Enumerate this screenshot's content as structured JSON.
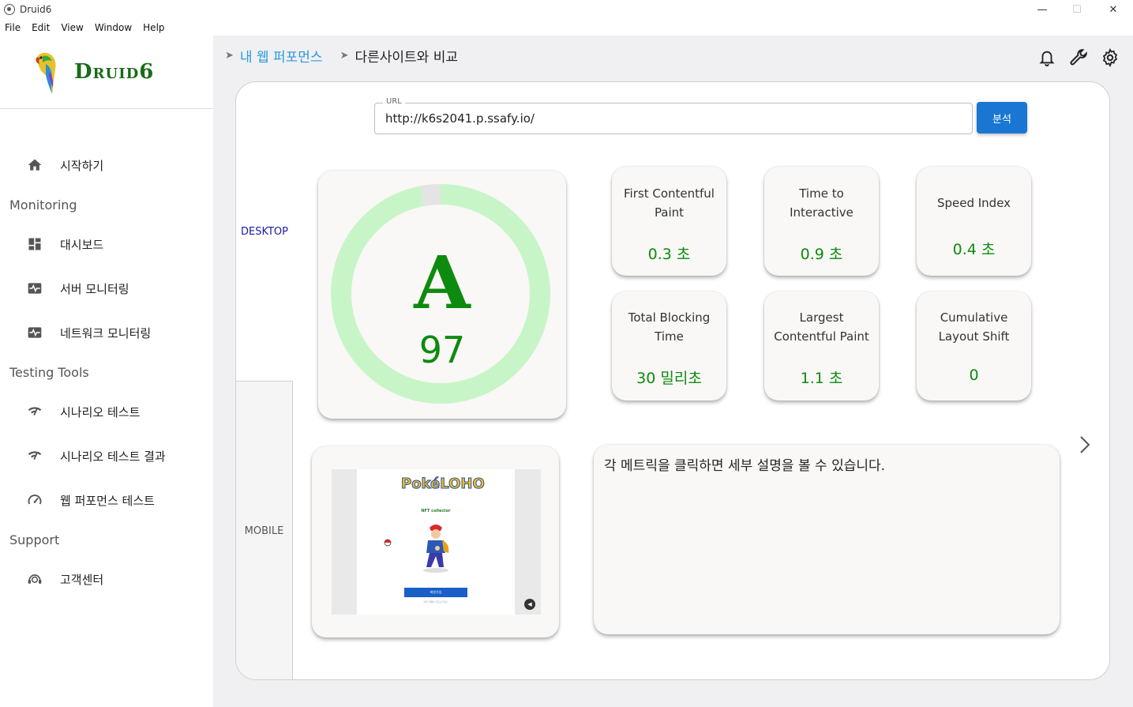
{
  "window": {
    "title": "Druid6",
    "minimize": "—",
    "maximize": "☐",
    "close": "✕"
  },
  "menu": [
    "File",
    "Edit",
    "View",
    "Window",
    "Help"
  ],
  "brand": {
    "name": "Druid6"
  },
  "sidebar": {
    "start": {
      "label": "시작하기",
      "icon": "home-icon"
    },
    "sections": [
      {
        "title": "Monitoring",
        "items": [
          {
            "label": "대시보드",
            "icon": "dashboard-icon"
          },
          {
            "label": "서버 모니터링",
            "icon": "monitor-heart-icon"
          },
          {
            "label": "네트워크 모니터링",
            "icon": "monitor-heart-icon"
          }
        ]
      },
      {
        "title": "Testing Tools",
        "items": [
          {
            "label": "시나리오 테스트",
            "icon": "network-check-icon"
          },
          {
            "label": "시나리오 테스트 결과",
            "icon": "network-check-icon"
          },
          {
            "label": "웹 퍼포먼스 테스트",
            "icon": "speed-icon"
          }
        ]
      },
      {
        "title": "Support",
        "items": [
          {
            "label": "고객센터",
            "icon": "support-agent-icon"
          }
        ]
      }
    ]
  },
  "breadcrumb": {
    "parent": "내 웹 퍼포먼스",
    "current": "다른사이트와 비교"
  },
  "header_icons": [
    "bell-icon",
    "wrench-icon",
    "gear-icon"
  ],
  "url_field": {
    "label": "URL",
    "value": "http://k6s2041.p.ssafy.io/"
  },
  "analyze_button": "분석",
  "tabs": {
    "desktop": "DESKTOP",
    "mobile": "MOBILE"
  },
  "score": {
    "grade": "A",
    "value": 97,
    "ring_color": "#c8f5c8",
    "gap_color": "#e4e4e4",
    "text_color": "#0e8a0e"
  },
  "metrics": [
    {
      "title": [
        "First Contentful",
        "Paint"
      ],
      "value": "0.3 초"
    },
    {
      "title": [
        "Time to",
        "Interactive"
      ],
      "value": "0.9 초"
    },
    {
      "title": [
        "Speed Index"
      ],
      "value": "0.4 초"
    },
    {
      "title": [
        "Total Blocking",
        "Time"
      ],
      "value": "30 밀리초"
    },
    {
      "title": [
        "Largest",
        "Contentful Paint"
      ],
      "value": "1.1 초"
    },
    {
      "title": [
        "Cumulative",
        "Layout Shift"
      ],
      "value": "0"
    }
  ],
  "description": "각 메트릭을 클릭하면 세부 설명을 볼 수 있습니다.",
  "screenshot": {
    "logo": "PokéLOHO",
    "caption": "NFT collector",
    "button": "회원가입",
    "footnote": "이미 계정이 있으신가요?"
  }
}
